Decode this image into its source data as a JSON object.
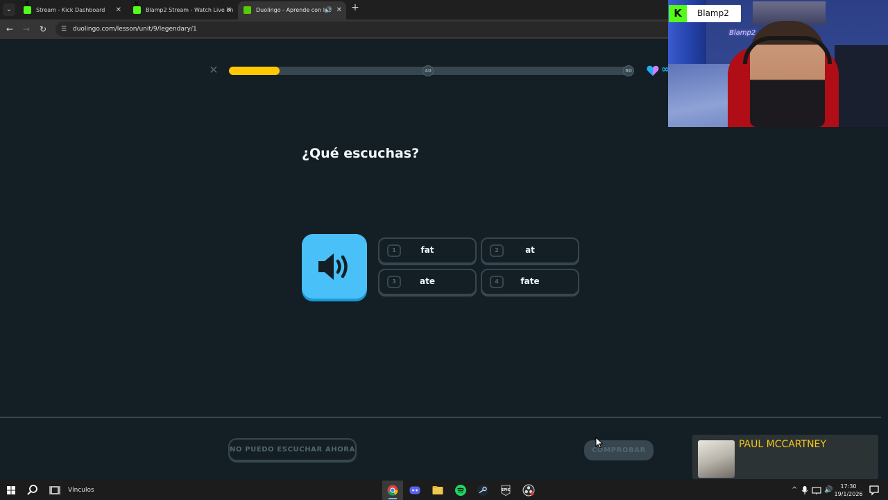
{
  "browser": {
    "tabs": [
      {
        "title": "Stream - Kick Dashboard",
        "icon": "kick-icon",
        "active": false
      },
      {
        "title": "Blamp2 Stream - Watch Live on",
        "icon": "kick-icon",
        "active": false
      },
      {
        "title": "Duolingo - Aprende con lec",
        "icon": "duolingo-icon",
        "active": true
      }
    ],
    "url": "duolingo.com/lesson/unit/9/legendary/1"
  },
  "lesson": {
    "progress_fraction": 0.125,
    "milestones": [
      "40",
      "80"
    ],
    "hearts": "∞",
    "prompt": "¿Qué escuchas?",
    "choices": [
      {
        "key": "1",
        "text": "fat"
      },
      {
        "key": "2",
        "text": "at"
      },
      {
        "key": "3",
        "text": "ate"
      },
      {
        "key": "4",
        "text": "fate"
      }
    ],
    "skip_label": "NO PUEDO ESCUCHAR AHORA",
    "check_label": "COMPROBAR"
  },
  "stream": {
    "channel_name": "Blamp2",
    "neon_sign": "Blamp2",
    "now_playing_artist": "PAUL MCCARTNEY"
  },
  "taskbar": {
    "links_label": "Vínculos",
    "time": "17:30",
    "date": "19/1/2026"
  },
  "colors": {
    "background": "#131f24",
    "progress": "#ffc800",
    "speaker": "#49c0f8",
    "kick_green": "#53fc18"
  }
}
